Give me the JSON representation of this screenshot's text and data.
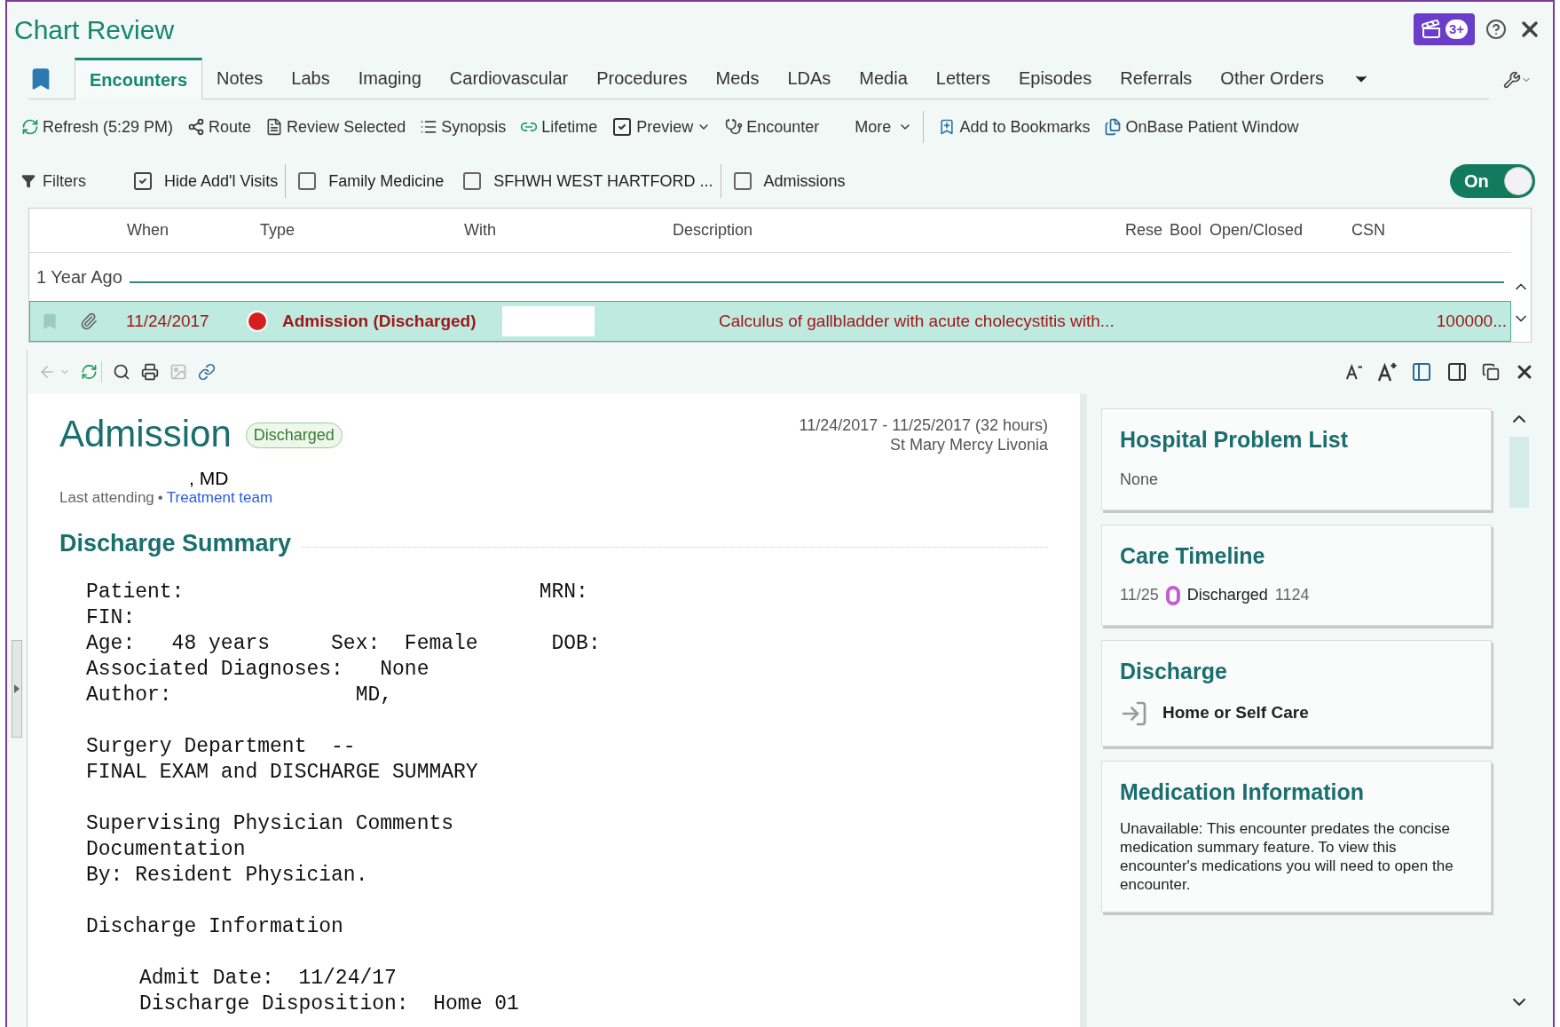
{
  "window": {
    "title": "Chart Review",
    "badge": "3+"
  },
  "tabs": [
    {
      "label": "Encounters",
      "selected": true
    },
    {
      "label": "Notes",
      "selected": false
    },
    {
      "label": "Labs",
      "selected": false
    },
    {
      "label": "Imaging",
      "selected": false
    },
    {
      "label": "Cardiovascular",
      "selected": false
    },
    {
      "label": "Procedures",
      "selected": false
    },
    {
      "label": "Meds",
      "selected": false
    },
    {
      "label": "LDAs",
      "selected": false
    },
    {
      "label": "Media",
      "selected": false
    },
    {
      "label": "Letters",
      "selected": false
    },
    {
      "label": "Episodes",
      "selected": false
    },
    {
      "label": "Referrals",
      "selected": false
    },
    {
      "label": "Other Orders",
      "selected": false
    }
  ],
  "toolbar": [
    {
      "kind": "refresh",
      "label": "Refresh (5:29 PM)"
    },
    {
      "kind": "route",
      "label": "Route"
    },
    {
      "kind": "review",
      "label": "Review Selected"
    },
    {
      "kind": "synopsis",
      "label": "Synopsis"
    },
    {
      "kind": "lifetime",
      "label": "Lifetime"
    },
    {
      "kind": "preview",
      "label": "Preview",
      "checked": true
    },
    {
      "kind": "encounter",
      "label": "Encounter"
    },
    {
      "kind": "more",
      "label": "More"
    },
    {
      "kind": "bookmark",
      "label": "Add to Bookmarks"
    },
    {
      "kind": "onbase",
      "label": "OnBase Patient Window"
    }
  ],
  "filters": {
    "label": "Filters",
    "options": [
      {
        "label": "Hide Add'l Visits",
        "checked": true
      },
      {
        "label": "Family Medicine",
        "checked": false
      },
      {
        "label": "SFHWH WEST HARTFORD ...",
        "checked": false
      },
      {
        "label": "Admissions",
        "checked": false
      }
    ],
    "toggle": {
      "label": "On",
      "on": true
    }
  },
  "table": {
    "columns": [
      "When",
      "Type",
      "With",
      "Description",
      "Rese",
      "Bool",
      "Open/Closed",
      "CSN"
    ],
    "group": "1 Year Ago",
    "rows": [
      {
        "when": "11/24/2017",
        "type": "Admission (Discharged)",
        "description": "Calculus of gallbladder with acute cholecystitis with...",
        "csn": "100000...",
        "selected": true
      }
    ]
  },
  "document": {
    "title": "Admission",
    "status": "Discharged",
    "dates": "11/24/2017 - 11/25/2017 (32 hours)",
    "location": "St Mary Mercy Livonia",
    "attending": ", MD",
    "attending_label": "Last attending",
    "separator": "•",
    "team_link": "Treatment team",
    "section": "Discharge Summary",
    "blocks": [
      {
        "indented": false,
        "lines": [
          "Patient:                             MRN:",
          "FIN:",
          "Age:   48 years     Sex:  Female      DOB:",
          "Associated Diagnoses:   None",
          "Author:               MD,"
        ]
      },
      {
        "indented": false,
        "lines": [
          "Surgery Department  --",
          "FINAL EXAM and DISCHARGE SUMMARY"
        ]
      },
      {
        "indented": false,
        "lines": [
          "Supervising Physician Comments",
          "Documentation",
          "By: Resident Physician."
        ]
      },
      {
        "indented": false,
        "lines": [
          "Discharge Information"
        ]
      },
      {
        "indented": true,
        "lines": [
          "Admit Date:  11/24/17",
          "Discharge Disposition:  Home 01"
        ]
      }
    ]
  },
  "side_cards": [
    {
      "kind": "text",
      "title": "Hospital Problem List",
      "text": "None"
    },
    {
      "kind": "timeline",
      "title": "Care Timeline",
      "date": "11/25",
      "event": "Discharged",
      "time": "1124"
    },
    {
      "kind": "discharge",
      "title": "Discharge",
      "text": "Home or Self Care"
    },
    {
      "kind": "paragraph",
      "title": "Medication Information",
      "text": "Unavailable: This encounter predates the concise medication summary feature. To view this encounter's medications you will need to open the encounter."
    }
  ]
}
